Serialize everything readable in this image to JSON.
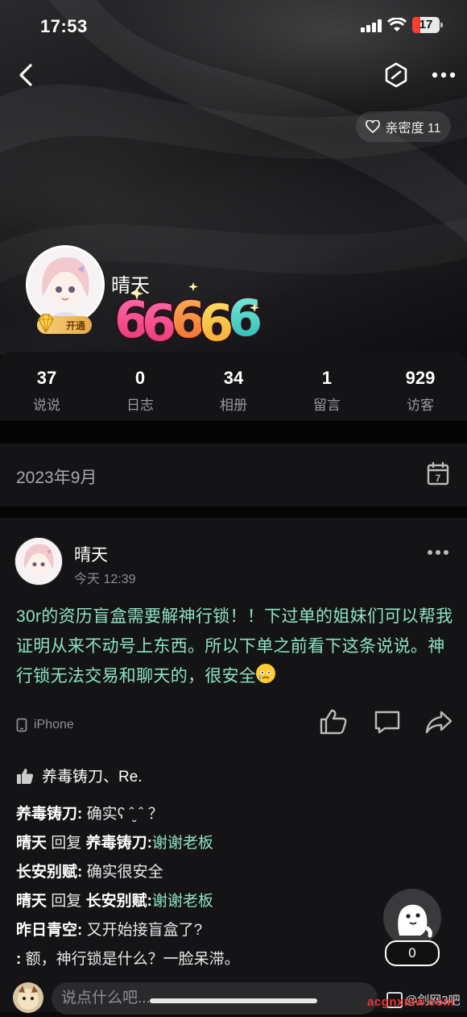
{
  "status_bar": {
    "time": "17:53",
    "battery": "17"
  },
  "header": {
    "intimacy_label": "亲密度 11"
  },
  "profile": {
    "nickname": "晴天",
    "vip_label": "开通",
    "sticker_text": "66666"
  },
  "stats": [
    {
      "value": "37",
      "label": "说说"
    },
    {
      "value": "0",
      "label": "日志"
    },
    {
      "value": "34",
      "label": "相册"
    },
    {
      "value": "1",
      "label": "留言"
    },
    {
      "value": "929",
      "label": "访客"
    }
  ],
  "timeline": {
    "month": "2023年9月",
    "calendar_day": "7"
  },
  "post": {
    "author": "晴天",
    "time": "今天 12:39",
    "content": "30r的资历盲盒需要解神行锁！！下过单的姐妹们可以帮我证明从来不动号上东西。所以下单之前看下这条说说。神行锁无法交易和聊天的，很安全",
    "device": "iPhone",
    "likes": "养毒铸刀、Re.",
    "comments": [
      {
        "author": "养毒铸刀:",
        "text": "确实ʕ ˆ̮ ˆ ？"
      },
      {
        "author": "晴天",
        "reply_word": "回复",
        "target": "养毒铸刀:",
        "text": "谢谢老板"
      },
      {
        "author": "长安别赋:",
        "text": "确实很安全"
      },
      {
        "author": "晴天",
        "reply_word": "回复",
        "target": "长安别赋:",
        "text": "谢谢老板"
      },
      {
        "author": "昨日青空:",
        "text": "又开始接盲盒了?"
      },
      {
        "author": ":",
        "text": "额，神行锁是什么？一脸呆滞。"
      }
    ]
  },
  "floating": {
    "count": "0"
  },
  "bottom": {
    "placeholder": "说点什么吧...",
    "watermark": "@剑网3吧",
    "watermark_url": "acgnxmw.com"
  },
  "colors": {
    "accent_green": "#8ee3c2",
    "background": "#141416"
  }
}
